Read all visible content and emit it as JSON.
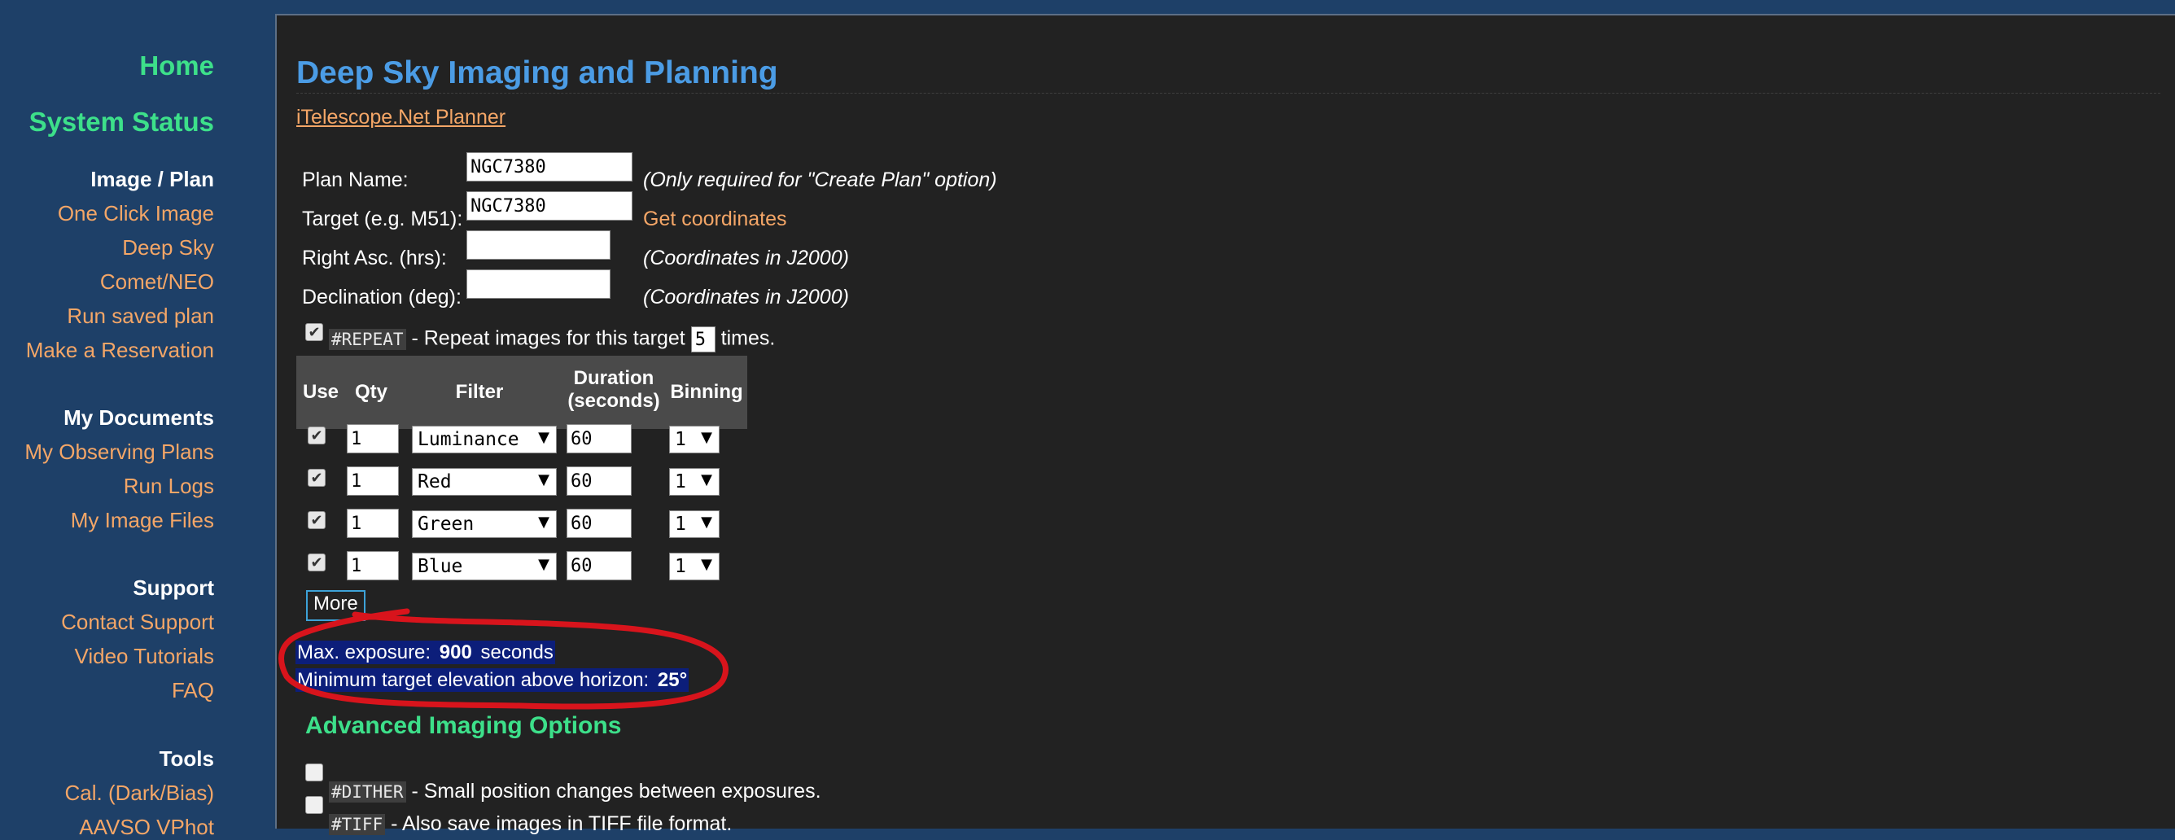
{
  "sidebar": {
    "home": "Home",
    "system_status": "System Status",
    "image_plan": {
      "heading": "Image / Plan",
      "items": [
        "One Click Image",
        "Deep Sky",
        "Comet/NEO",
        "Run saved plan",
        "Make a Reservation"
      ]
    },
    "my_documents": {
      "heading": "My Documents",
      "items": [
        "My Observing Plans",
        "Run Logs",
        "My Image Files"
      ]
    },
    "support": {
      "heading": "Support",
      "items": [
        "Contact Support",
        "Video Tutorials",
        "FAQ"
      ]
    },
    "tools": {
      "heading": "Tools",
      "items": [
        "Cal. (Dark/Bias)",
        "AAVSO VPhot"
      ]
    }
  },
  "main": {
    "title": "Deep Sky Imaging and Planning",
    "planner_link": "iTelescope.Net Planner",
    "form": {
      "plan_name_label": "Plan Name:",
      "plan_name_value": "NGC7380",
      "plan_name_note": "(Only required for \"Create Plan\" option)",
      "target_label": "Target (e.g. M51):",
      "target_value": "NGC7380",
      "get_coordinates": "Get coordinates",
      "ra_label": "Right Asc. (hrs):",
      "ra_value": "",
      "ra_note": "(Coordinates in J2000)",
      "dec_label": "Declination (deg):",
      "dec_value": "",
      "dec_note": "(Coordinates in J2000)"
    },
    "repeat": {
      "tag": "#REPEAT",
      "text_before": " - Repeat images for this target ",
      "count": "5",
      "text_after": " times."
    },
    "table": {
      "headers": {
        "use": "Use",
        "qty": "Qty",
        "filter": "Filter",
        "duration_line1": "Duration",
        "duration_line2": "(seconds)",
        "binning": "Binning"
      },
      "rows": [
        {
          "qty": "1",
          "filter": "Luminance",
          "duration": "60",
          "binning": "1"
        },
        {
          "qty": "1",
          "filter": "Red",
          "duration": "60",
          "binning": "1"
        },
        {
          "qty": "1",
          "filter": "Green",
          "duration": "60",
          "binning": "1"
        },
        {
          "qty": "1",
          "filter": "Blue",
          "duration": "60",
          "binning": "1"
        }
      ],
      "more_label": "More"
    },
    "info": {
      "max_exposure_prefix": "Max. exposure: ",
      "max_exposure_value": "900",
      "max_exposure_suffix": " seconds",
      "min_elev_prefix": "Minimum target elevation above horizon: ",
      "min_elev_value": "25°"
    },
    "advanced": {
      "title": "Advanced Imaging Options",
      "dither_tag": "#DITHER",
      "dither_text": " - Small position changes between exposures.",
      "tiff_tag": "#TIFF",
      "tiff_text": " - Also save images in TIFF file format."
    },
    "colors": {
      "annotation": "#d8141c",
      "accent_green": "#3de08a",
      "title_blue": "#4b9ce5",
      "link_orange": "#f4a667",
      "highlight": "#0c1e7a"
    }
  }
}
